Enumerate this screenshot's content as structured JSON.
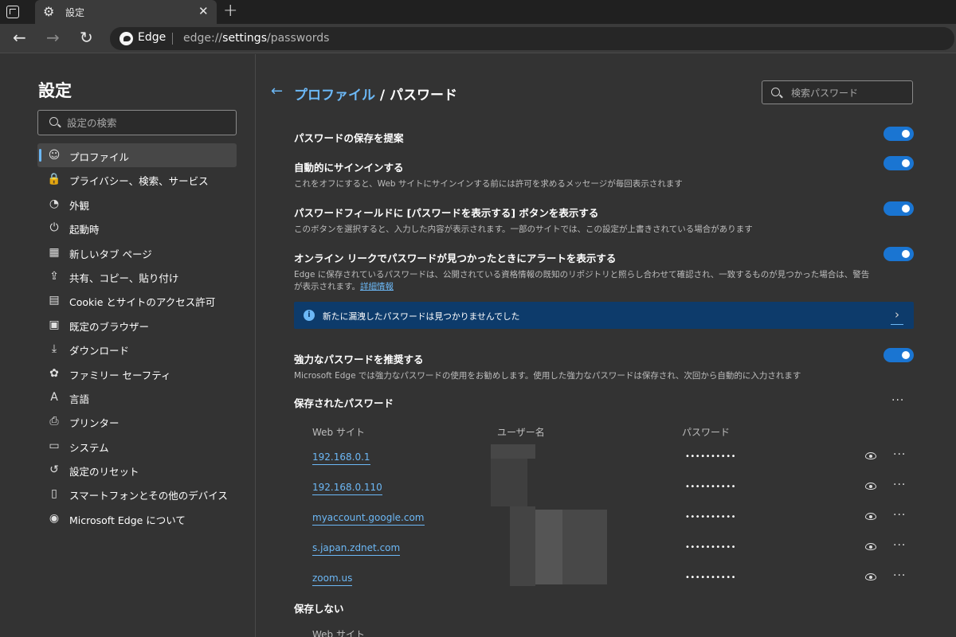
{
  "tab": {
    "title": "設定"
  },
  "address": {
    "brand": "Edge",
    "scheme": "edge://",
    "host": "settings",
    "path": "/passwords"
  },
  "sidebar": {
    "title": "設定",
    "search_placeholder": "設定の検索",
    "items": [
      {
        "label": "プロファイル",
        "icon": "profile-icon",
        "glyph": "☺"
      },
      {
        "label": "プライバシー、検索、サービス",
        "icon": "lock-icon",
        "glyph": "🔒"
      },
      {
        "label": "外観",
        "icon": "palette-icon",
        "glyph": "◔"
      },
      {
        "label": "起動時",
        "icon": "power-icon",
        "glyph": "⏻"
      },
      {
        "label": "新しいタブ ページ",
        "icon": "newtab-icon",
        "glyph": "▦"
      },
      {
        "label": "共有、コピー、貼り付け",
        "icon": "share-icon",
        "glyph": "⇪"
      },
      {
        "label": "Cookie とサイトのアクセス許可",
        "icon": "cookie-icon",
        "glyph": "▤"
      },
      {
        "label": "既定のブラウザー",
        "icon": "browser-icon",
        "glyph": "▣"
      },
      {
        "label": "ダウンロード",
        "icon": "download-icon",
        "glyph": "⤓"
      },
      {
        "label": "ファミリー セーフティ",
        "icon": "family-icon",
        "glyph": "✿"
      },
      {
        "label": "言語",
        "icon": "language-icon",
        "glyph": "A"
      },
      {
        "label": "プリンター",
        "icon": "printer-icon",
        "glyph": "⎙"
      },
      {
        "label": "システム",
        "icon": "system-icon",
        "glyph": "▭"
      },
      {
        "label": "設定のリセット",
        "icon": "reset-icon",
        "glyph": "↺"
      },
      {
        "label": "スマートフォンとその他のデバイス",
        "icon": "phone-icon",
        "glyph": "▯"
      },
      {
        "label": "Microsoft Edge について",
        "icon": "edge-icon",
        "glyph": "◉"
      }
    ]
  },
  "main": {
    "breadcrumb_link": "プロファイル",
    "breadcrumb_sep": " / ",
    "breadcrumb_current": "パスワード",
    "search_placeholder": "検索パスワード",
    "settings": [
      {
        "title": "パスワードの保存を提案",
        "desc": ""
      },
      {
        "title": "自動的にサインインする",
        "desc": "これをオフにすると、Web サイトにサインインする前には許可を求めるメッセージが毎回表示されます"
      },
      {
        "title": "パスワードフィールドに [パスワードを表示する] ボタンを表示する",
        "desc": "このボタンを選択すると、入力した内容が表示されます。一部のサイトでは、この設定が上書きされている場合があります"
      },
      {
        "title": "オンライン リークでパスワードが見つかったときにアラートを表示する",
        "desc": "Edge に保存されているパスワードは、公開されている資格情報の既知のリポジトリと照らし合わせて確認され、一致するものが見つかった場合は、警告が表示されます。",
        "link": "詳細情報"
      },
      {
        "title": "強力なパスワードを推奨する",
        "desc": "Microsoft Edge では強力なパスワードの使用をお勧めします。使用した強力なパスワードは保存され、次回から自動的に入力されます"
      }
    ],
    "leak_notice": "新たに漏洩したパスワードは見つかりませんでした",
    "saved_heading": "保存されたパスワード",
    "columns": {
      "site": "Web サイト",
      "user": "ユーザー名",
      "password": "パスワード"
    },
    "passwords": [
      {
        "site": "192.168.0.1",
        "password": "••••••••••"
      },
      {
        "site": "192.168.0.110",
        "password": "••••••••••"
      },
      {
        "site": "myaccount.google.com",
        "password": "••••••••••"
      },
      {
        "site": "s.japan.zdnet.com",
        "password": "••••••••••"
      },
      {
        "site": "zoom.us",
        "password": "••••••••••"
      }
    ],
    "never_saved_heading": "保存しない",
    "never_saved_col": "Web サイト"
  }
}
